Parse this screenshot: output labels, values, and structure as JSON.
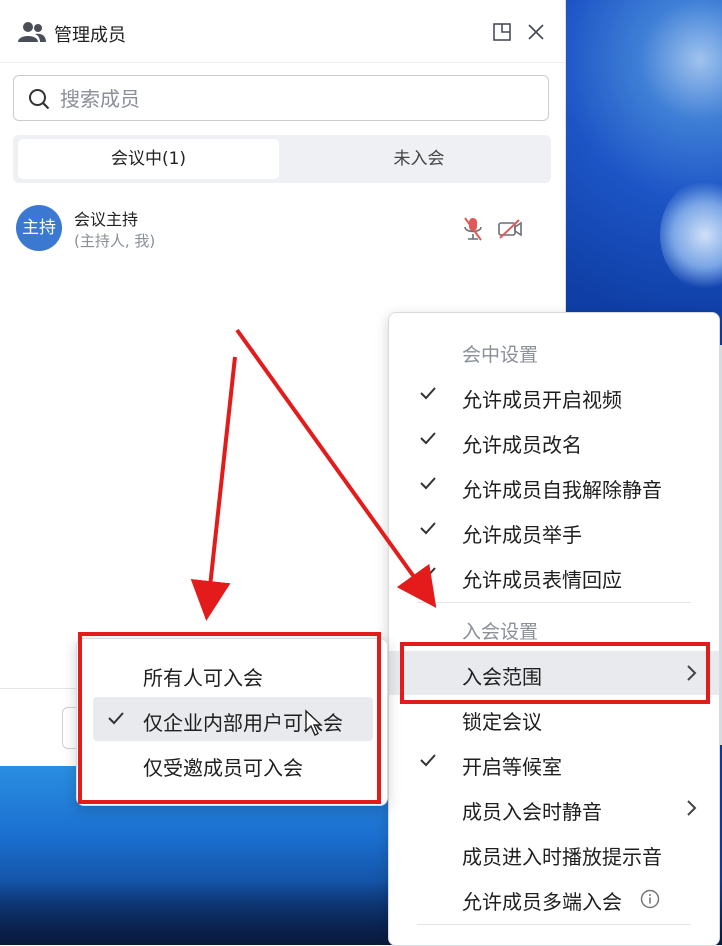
{
  "panel": {
    "title": "管理成员",
    "search": {
      "placeholder": "搜索成员",
      "value": ""
    },
    "tabs": [
      {
        "label": "会议中(1)",
        "active": true
      },
      {
        "label": "未入会",
        "active": false
      }
    ],
    "members": [
      {
        "avatar_text": "主持",
        "name": "会议主持",
        "role": "(主持人, 我)",
        "mic": "muted",
        "camera": "off"
      }
    ]
  },
  "menu": {
    "section_meeting": "会中设置",
    "meeting_items": [
      {
        "label": "允许成员开启视频",
        "checked": true
      },
      {
        "label": "允许成员改名",
        "checked": true
      },
      {
        "label": "允许成员自我解除静音",
        "checked": true
      },
      {
        "label": "允许成员举手",
        "checked": true
      },
      {
        "label": "允许成员表情回应",
        "checked": true
      }
    ],
    "section_join": "入会设置",
    "join_items": [
      {
        "label": "入会范围",
        "checked": false,
        "submenu": true,
        "highlighted": true
      },
      {
        "label": "锁定会议",
        "checked": false
      },
      {
        "label": "开启等候室",
        "checked": true
      },
      {
        "label": "成员入会时静音",
        "checked": false,
        "submenu": true
      },
      {
        "label": "成员进入时播放提示音",
        "checked": false
      },
      {
        "label": "允许成员多端入会",
        "checked": false,
        "info": true
      }
    ]
  },
  "submenu": {
    "items": [
      {
        "label": "所有人可入会",
        "checked": false
      },
      {
        "label": "仅企业内部用户可入会",
        "checked": true
      },
      {
        "label": "仅受邀成员可入会",
        "checked": false
      }
    ]
  },
  "colors": {
    "accent": "#3b78d1",
    "annotation": "#e41b1b",
    "muted_icon": "#e05a5a"
  }
}
